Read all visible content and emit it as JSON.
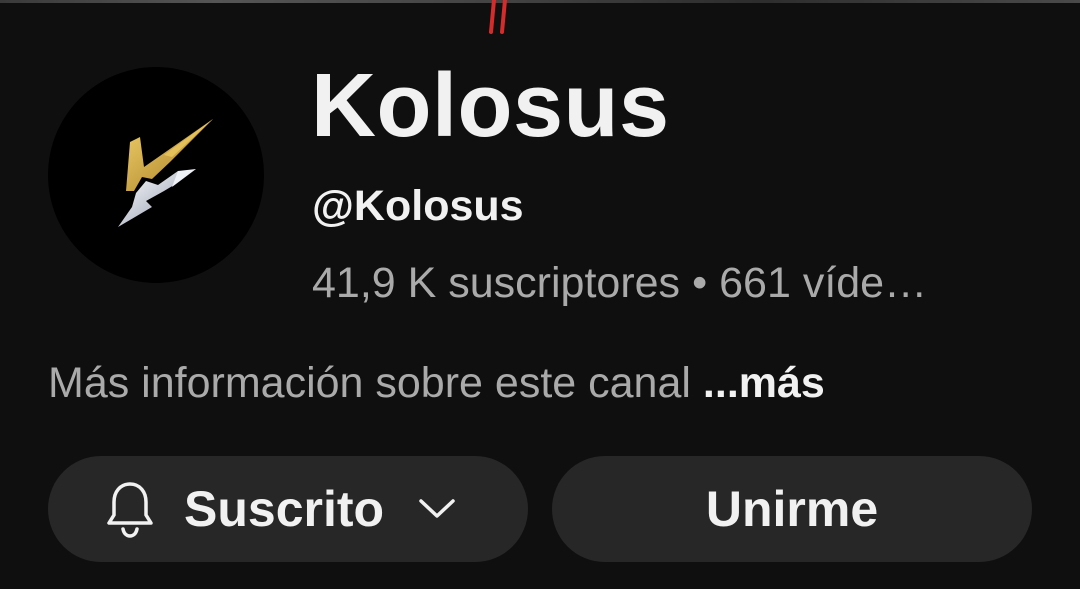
{
  "channel": {
    "name": "Kolosus",
    "handle": "@Kolosus",
    "subscribers": "41,9 K suscriptores",
    "separator": "•",
    "videos": "661 víde…",
    "avatar_icon": "kolosus-lightning-k-logo"
  },
  "about": {
    "text": "Más información sobre este canal",
    "more_label": "...más"
  },
  "actions": {
    "subscribed_label": "Suscrito",
    "bell_icon": "bell-icon",
    "chevron_icon": "chevron-down-icon",
    "join_label": "Unirme"
  },
  "colors": {
    "background": "#0f0f0f",
    "button_bg": "#272727",
    "primary_text": "#f1f1f1",
    "secondary_text": "#aaaaaa",
    "logo_gold": "#c9a33a",
    "logo_silver": "#d8dde8"
  }
}
